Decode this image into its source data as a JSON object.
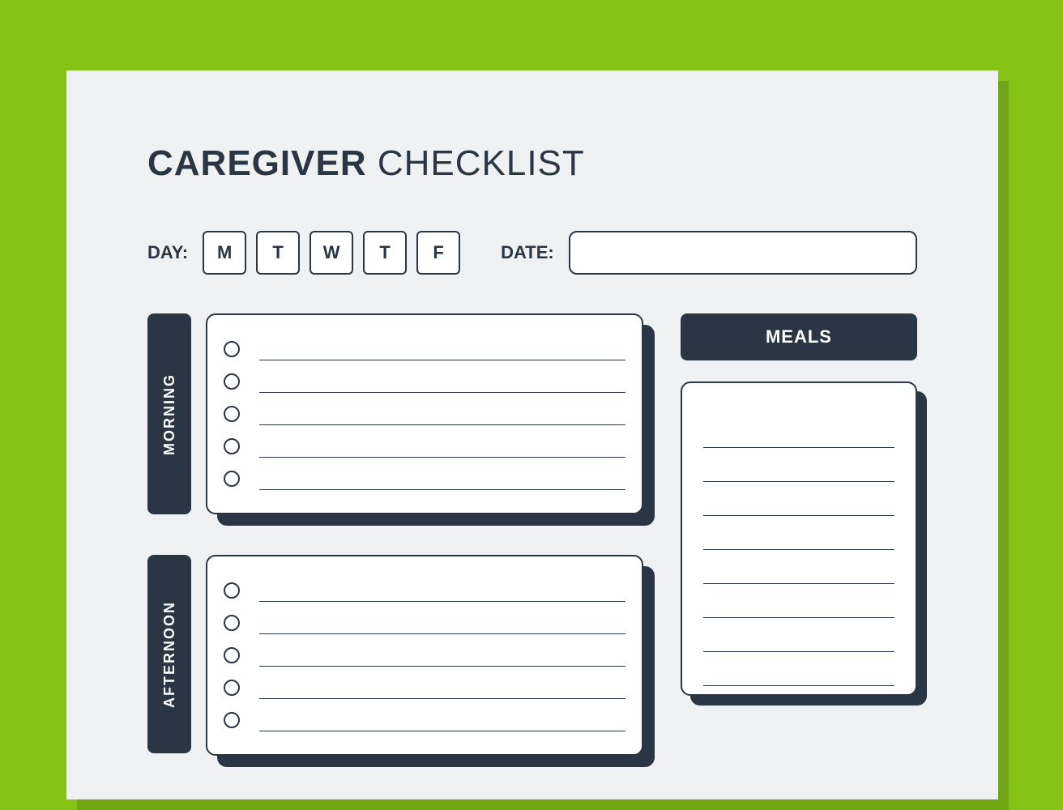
{
  "title": {
    "bold": "CAREGIVER",
    "light": "CHECKLIST"
  },
  "dayRow": {
    "dayLabel": "DAY:",
    "dateLabel": "DATE:",
    "days": [
      "M",
      "T",
      "W",
      "T",
      "F"
    ],
    "dateValue": ""
  },
  "sections": {
    "morning": {
      "label": "MORNING",
      "itemCount": 5
    },
    "afternoon": {
      "label": "AFTERNOON",
      "itemCount": 5
    }
  },
  "meals": {
    "header": "MEALS",
    "lineCount": 8
  },
  "colors": {
    "background": "#85c215",
    "page": "#eff1f2",
    "dark": "#2a3644",
    "white": "#ffffff"
  }
}
